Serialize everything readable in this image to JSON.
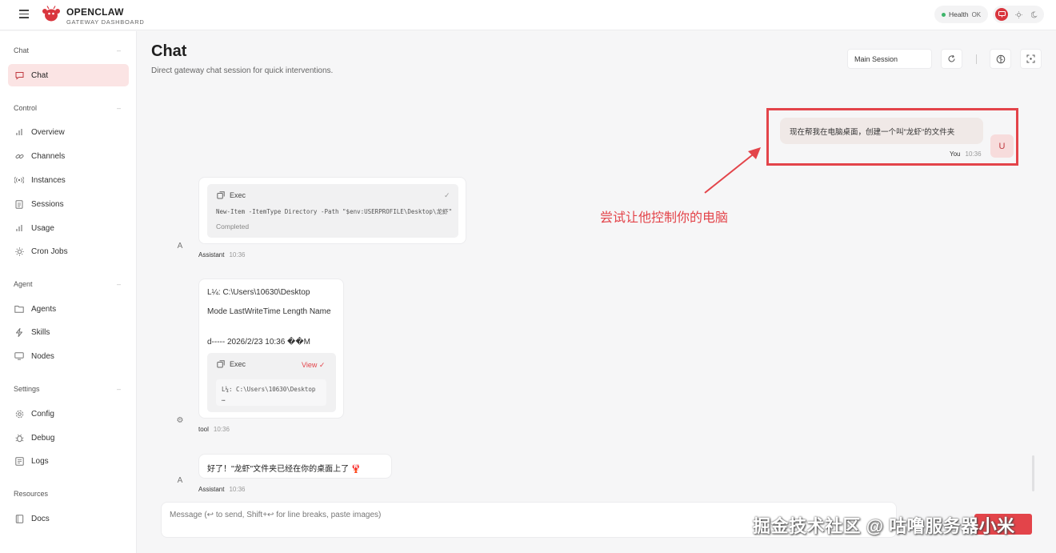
{
  "header": {
    "brand_title": "OPENCLAW",
    "brand_sub": "GATEWAY DASHBOARD",
    "health_label": "Health",
    "health_status": "OK"
  },
  "sidebar": {
    "groups": [
      {
        "label": "Chat",
        "items": [
          {
            "label": "Chat",
            "icon": "chat-icon",
            "active": true
          }
        ]
      },
      {
        "label": "Control",
        "items": [
          {
            "label": "Overview",
            "icon": "bar-chart-icon"
          },
          {
            "label": "Channels",
            "icon": "link-icon"
          },
          {
            "label": "Instances",
            "icon": "broadcast-icon"
          },
          {
            "label": "Sessions",
            "icon": "document-icon"
          },
          {
            "label": "Usage",
            "icon": "bar-chart-icon"
          },
          {
            "label": "Cron Jobs",
            "icon": "sun-icon"
          }
        ]
      },
      {
        "label": "Agent",
        "items": [
          {
            "label": "Agents",
            "icon": "folder-icon"
          },
          {
            "label": "Skills",
            "icon": "lightning-icon"
          },
          {
            "label": "Nodes",
            "icon": "monitor-icon"
          }
        ]
      },
      {
        "label": "Settings",
        "items": [
          {
            "label": "Config",
            "icon": "gear-icon"
          },
          {
            "label": "Debug",
            "icon": "bug-icon"
          },
          {
            "label": "Logs",
            "icon": "logs-icon"
          }
        ]
      },
      {
        "label": "Resources",
        "items": [
          {
            "label": "Docs",
            "icon": "book-icon"
          }
        ]
      }
    ]
  },
  "main": {
    "title": "Chat",
    "subtitle": "Direct gateway chat session for quick interventions.",
    "session": "Main Session"
  },
  "messages": {
    "user": {
      "text": "现在帮我在电脑桌面，创建一个叫\"龙虾\"的文件夹",
      "author": "You",
      "time": "10:36",
      "avatar": "U"
    },
    "exec1": {
      "label": "Exec",
      "command": "New-Item -ItemType Directory -Path \"$env:USERPROFILE\\Desktop\\龙虾\"",
      "status": "Completed",
      "author": "Assistant",
      "time": "10:36",
      "avatar": "A"
    },
    "tool": {
      "line1": "L¼: C:\\Users\\10630\\Desktop",
      "line2": "Mode LastWriteTime Length Name",
      "line3": "d----- 2026/2/23 10:36 ��M",
      "exec_label": "Exec",
      "view_label": "View",
      "cmd_line1": "L¼: C:\\Users\\10630\\Desktop",
      "cmd_line2": "…",
      "author": "tool",
      "time": "10:36"
    },
    "reply": {
      "text": "好了！\"龙虾\"文件夹已经在你的桌面上了 🦞",
      "author": "Assistant",
      "time": "10:36",
      "avatar": "A"
    }
  },
  "annotation": "尝试让他控制你的电脑",
  "composer": {
    "placeholder": "Message (↩ to send, Shift+↩ for line breaks, paste images)"
  },
  "watermark": "掘金技术社区 @ 咕噜服务器小米",
  "colors": {
    "accent": "#e3444a",
    "active_bg": "#fbe4e4",
    "health_dot": "#3fb56b"
  }
}
